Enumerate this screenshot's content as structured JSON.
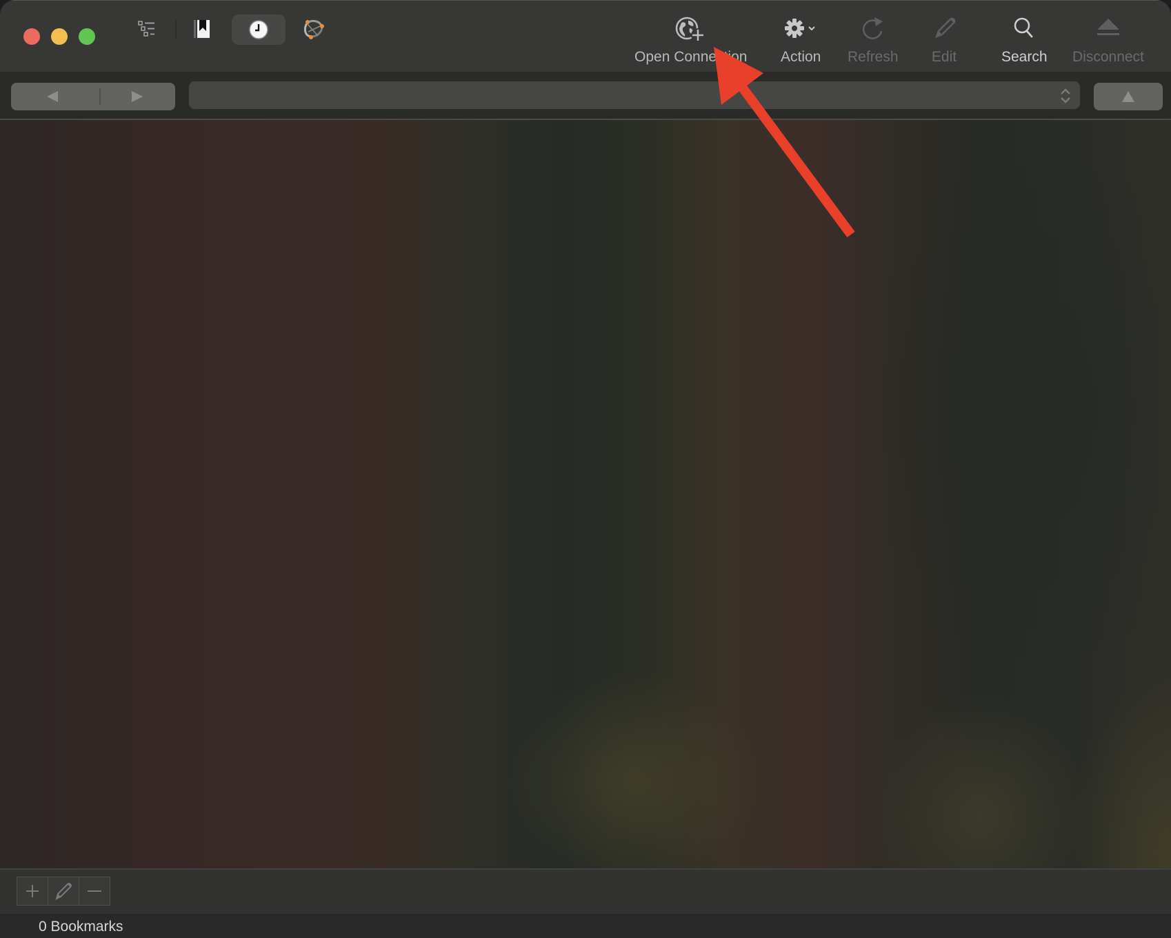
{
  "window": {
    "traffic_lights": [
      "close",
      "minimize",
      "zoom"
    ]
  },
  "toolbar": {
    "view_icons": [
      {
        "name": "outline-view-icon"
      },
      {
        "name": "bookmarks-icon"
      },
      {
        "name": "history-icon",
        "selected": true
      },
      {
        "name": "bonjour-icon"
      }
    ],
    "tools": [
      {
        "label": "Open Connection",
        "icon": "globe-plus-icon",
        "enabled": true
      },
      {
        "label": "Action",
        "icon": "gear-dropdown-icon",
        "enabled": true
      },
      {
        "label": "Refresh",
        "icon": "refresh-icon",
        "enabled": false
      },
      {
        "label": "Edit",
        "icon": "pencil-icon",
        "enabled": false
      },
      {
        "label": "Search",
        "icon": "search-icon",
        "enabled": true
      },
      {
        "label": "Disconnect",
        "icon": "eject-icon",
        "enabled": false
      }
    ]
  },
  "navbar": {
    "back_icon": "back-arrow-icon",
    "forward_icon": "forward-arrow-icon",
    "path_value": "",
    "up_icon": "up-arrow-icon"
  },
  "bottombar": {
    "buttons": [
      {
        "name": "add-bookmark-button",
        "icon": "plus-icon"
      },
      {
        "name": "edit-bookmark-button",
        "icon": "pencil-icon"
      },
      {
        "name": "remove-bookmark-button",
        "icon": "minus-icon"
      }
    ]
  },
  "status": {
    "text": "0 Bookmarks"
  },
  "annotation": {
    "type": "arrow",
    "color": "#e8402a",
    "points_to": "Open Connection"
  },
  "colors": {
    "toolbar_bg": "#373736",
    "label_enabled": "#b9b9b9",
    "label_disabled": "#6b6b6b",
    "close": "#ec6a5e",
    "minimize": "#f4bf4f",
    "zoom": "#61c554"
  }
}
